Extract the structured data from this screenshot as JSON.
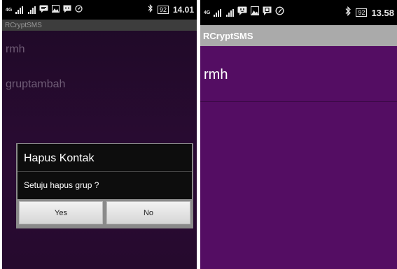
{
  "left": {
    "status": {
      "network": "4G",
      "time": "14.01",
      "battery": "92"
    },
    "app_title": "RCryptSMS",
    "items": [
      "rmh",
      "gruptambah"
    ],
    "dialog": {
      "title": "Hapus Kontak",
      "message": "Setuju hapus grup ?",
      "yes_label": "Yes",
      "no_label": "No"
    }
  },
  "right": {
    "status": {
      "network": "4G",
      "time": "13.58",
      "battery": "92"
    },
    "app_title": "RCryptSMS",
    "items": [
      "rmh"
    ]
  },
  "colors": {
    "left_background": "#240a2c",
    "right_background": "#540d63",
    "left_appbar": "#3d3d3d",
    "right_appbar": "#aaaaaa",
    "dialog_body": "#0d0d0d",
    "dialog_button": "#e6e6e6"
  }
}
